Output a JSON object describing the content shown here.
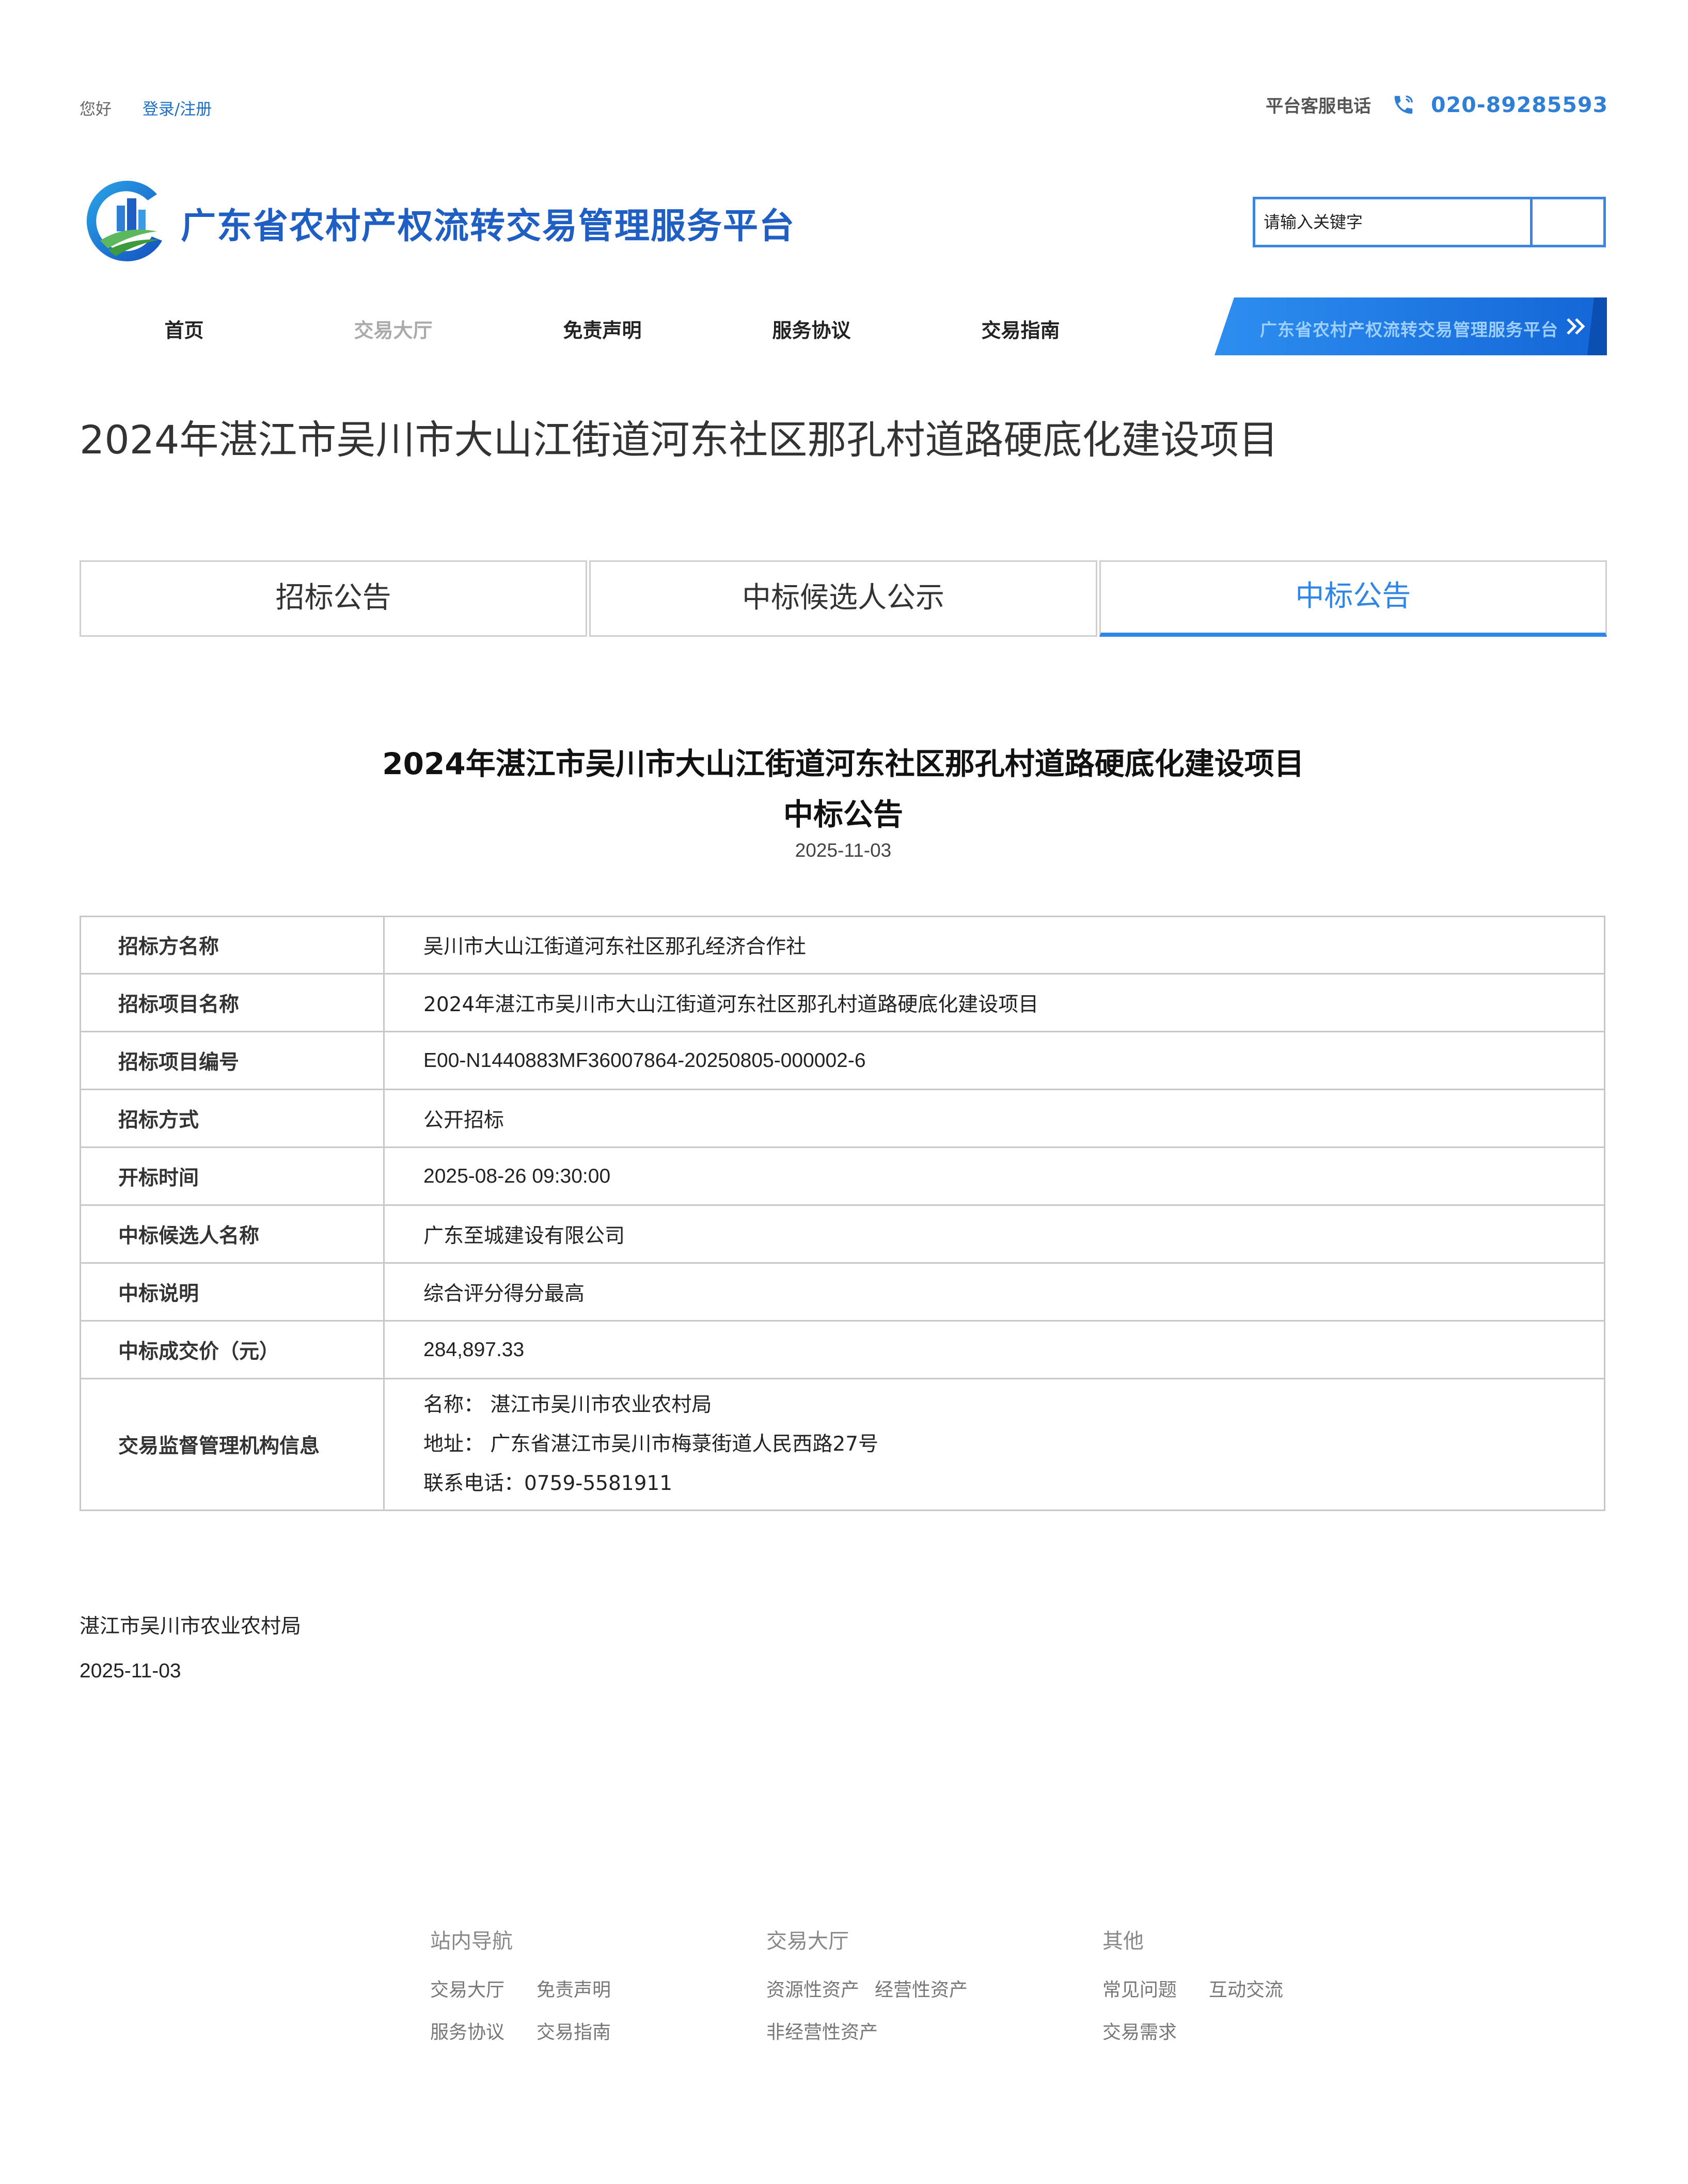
{
  "topbar": {
    "greeting": "您好",
    "login_label": "登录/注册",
    "hotline_label": "平台客服电话",
    "hotline_number": "020-89285593"
  },
  "site": {
    "title": "广东省农村产权流转交易管理服务平台"
  },
  "search": {
    "placeholder": "请输入关键字"
  },
  "nav": {
    "items": [
      {
        "label": "首页"
      },
      {
        "label": "交易大厅"
      },
      {
        "label": "免责声明"
      },
      {
        "label": "服务协议"
      },
      {
        "label": "交易指南"
      }
    ],
    "banner_label": "广东省农村产权流转交易管理服务平台"
  },
  "page": {
    "title": "2024年湛江市吴川市大山江街道河东社区那孔村道路硬底化建设项目"
  },
  "tabs": [
    {
      "label": "招标公告"
    },
    {
      "label": "中标候选人公示"
    },
    {
      "label": "中标公告"
    }
  ],
  "notice": {
    "title_line1": "2024年湛江市吴川市大山江街道河东社区那孔村道路硬底化建设项目",
    "title_line2": "中标公告",
    "date": "2025-11-03"
  },
  "info_table": {
    "rows": [
      {
        "key": "招标方名称",
        "value": "吴川市大山江街道河东社区那孔经济合作社"
      },
      {
        "key": "招标项目名称",
        "value": "2024年湛江市吴川市大山江街道河东社区那孔村道路硬底化建设项目"
      },
      {
        "key": "招标项目编号",
        "value": "E00-N1440883MF36007864-20250805-000002-6"
      },
      {
        "key": "招标方式",
        "value": "公开招标"
      },
      {
        "key": "开标时间",
        "value": "2025-08-26 09:30:00"
      },
      {
        "key": "中标候选人名称",
        "value": "广东至城建设有限公司"
      },
      {
        "key": "中标说明",
        "value": "综合评分得分最高"
      },
      {
        "key": "中标成交价（元）",
        "value": "284,897.33"
      }
    ],
    "supervisor": {
      "key": "交易监督管理机构信息",
      "name": "名称： 湛江市吴川市农业农村局",
      "address": "地址： 广东省湛江市吴川市梅菉街道人民西路27号",
      "phone": "联系电话：0759-5581911"
    }
  },
  "signature": {
    "org": "湛江市吴川市农业农村局",
    "date": "2025-11-03"
  },
  "footer": {
    "col1": {
      "heading": "站内导航",
      "links": [
        "交易大厅",
        "免责声明",
        "服务协议",
        "交易指南"
      ]
    },
    "col2": {
      "heading": "交易大厅",
      "links": [
        "资源性资产",
        "经营性资产",
        "非经营性资产"
      ]
    },
    "col3": {
      "heading": "其他",
      "links": [
        "常见问题",
        "互动交流",
        "交易需求"
      ]
    }
  },
  "colors": {
    "brand_blue": "#1f5fc4",
    "accent_blue": "#2f86e6",
    "border_gray": "#c8c8c8"
  }
}
